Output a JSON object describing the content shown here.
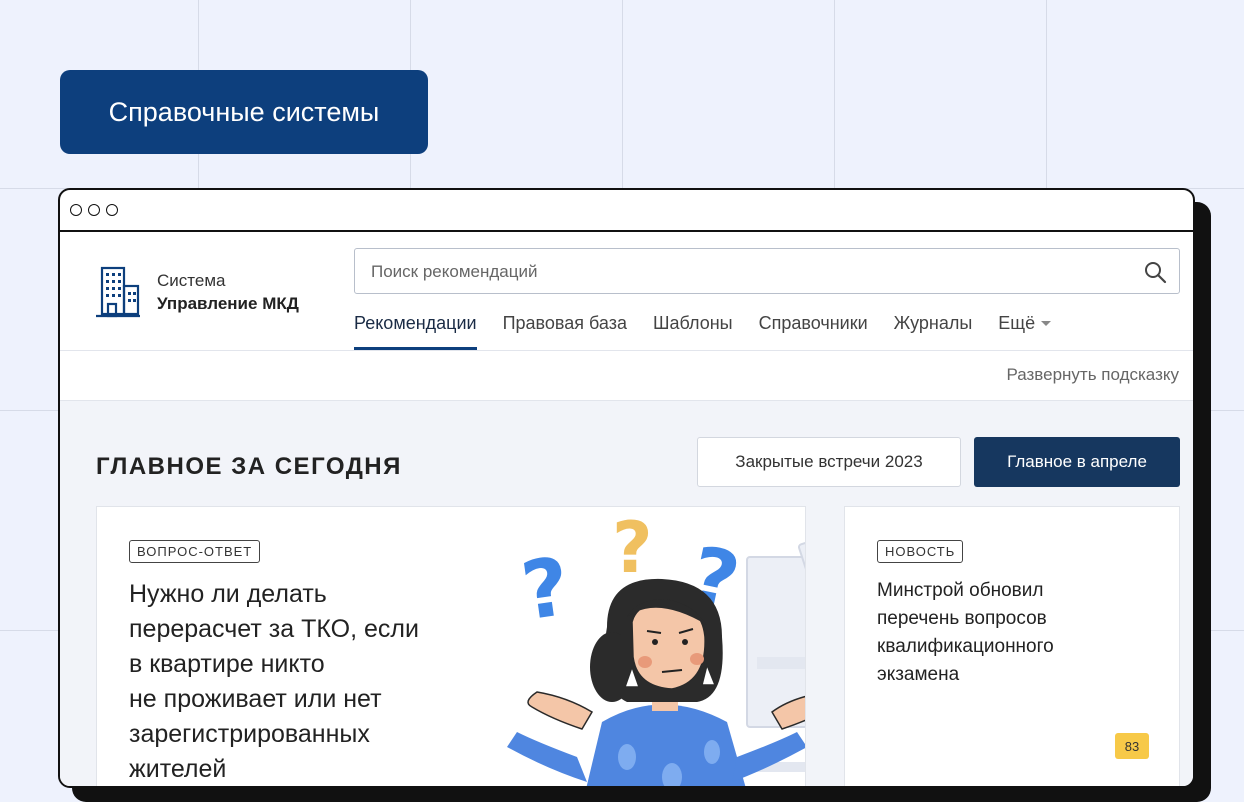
{
  "badge": {
    "label": "Справочные системы"
  },
  "brand": {
    "line1": "Система",
    "line2": "Управление МКД"
  },
  "search": {
    "placeholder": "Поиск рекомендаций"
  },
  "nav": {
    "items": [
      {
        "label": "Рекомендации",
        "active": true
      },
      {
        "label": "Правовая база"
      },
      {
        "label": "Шаблоны"
      },
      {
        "label": "Справочники"
      },
      {
        "label": "Журналы"
      },
      {
        "label": "Ещё"
      }
    ]
  },
  "hint": {
    "label": "Развернуть подсказку"
  },
  "main": {
    "title": "ГЛАВНОЕ ЗА СЕГОДНЯ",
    "btn_meetings": "Закрытые встречи 2023",
    "btn_april": "Главное в апреле"
  },
  "card_main": {
    "tag": "ВОПРОС-ОТВЕТ",
    "lines": [
      "Нужно ли делать",
      "перерасчет за ТКО, если",
      "в квартире никто",
      "не проживает или нет",
      "зарегистрированных",
      "жителей"
    ]
  },
  "card_side": {
    "tag": "НОВОСТЬ",
    "lines": [
      "Минстрой обновил",
      "перечень вопросов",
      "квалификационного",
      "экзамена"
    ],
    "counter": "83"
  },
  "colors": {
    "brand_blue": "#0d3f7d",
    "button_navy": "#16375f",
    "counter_yellow": "#f7c948",
    "question_blue": "#3f86e6",
    "question_yellow": "#f0c060"
  },
  "icons": {
    "logo": "building-icon",
    "search": "search-icon",
    "more": "chevron-down-icon"
  }
}
